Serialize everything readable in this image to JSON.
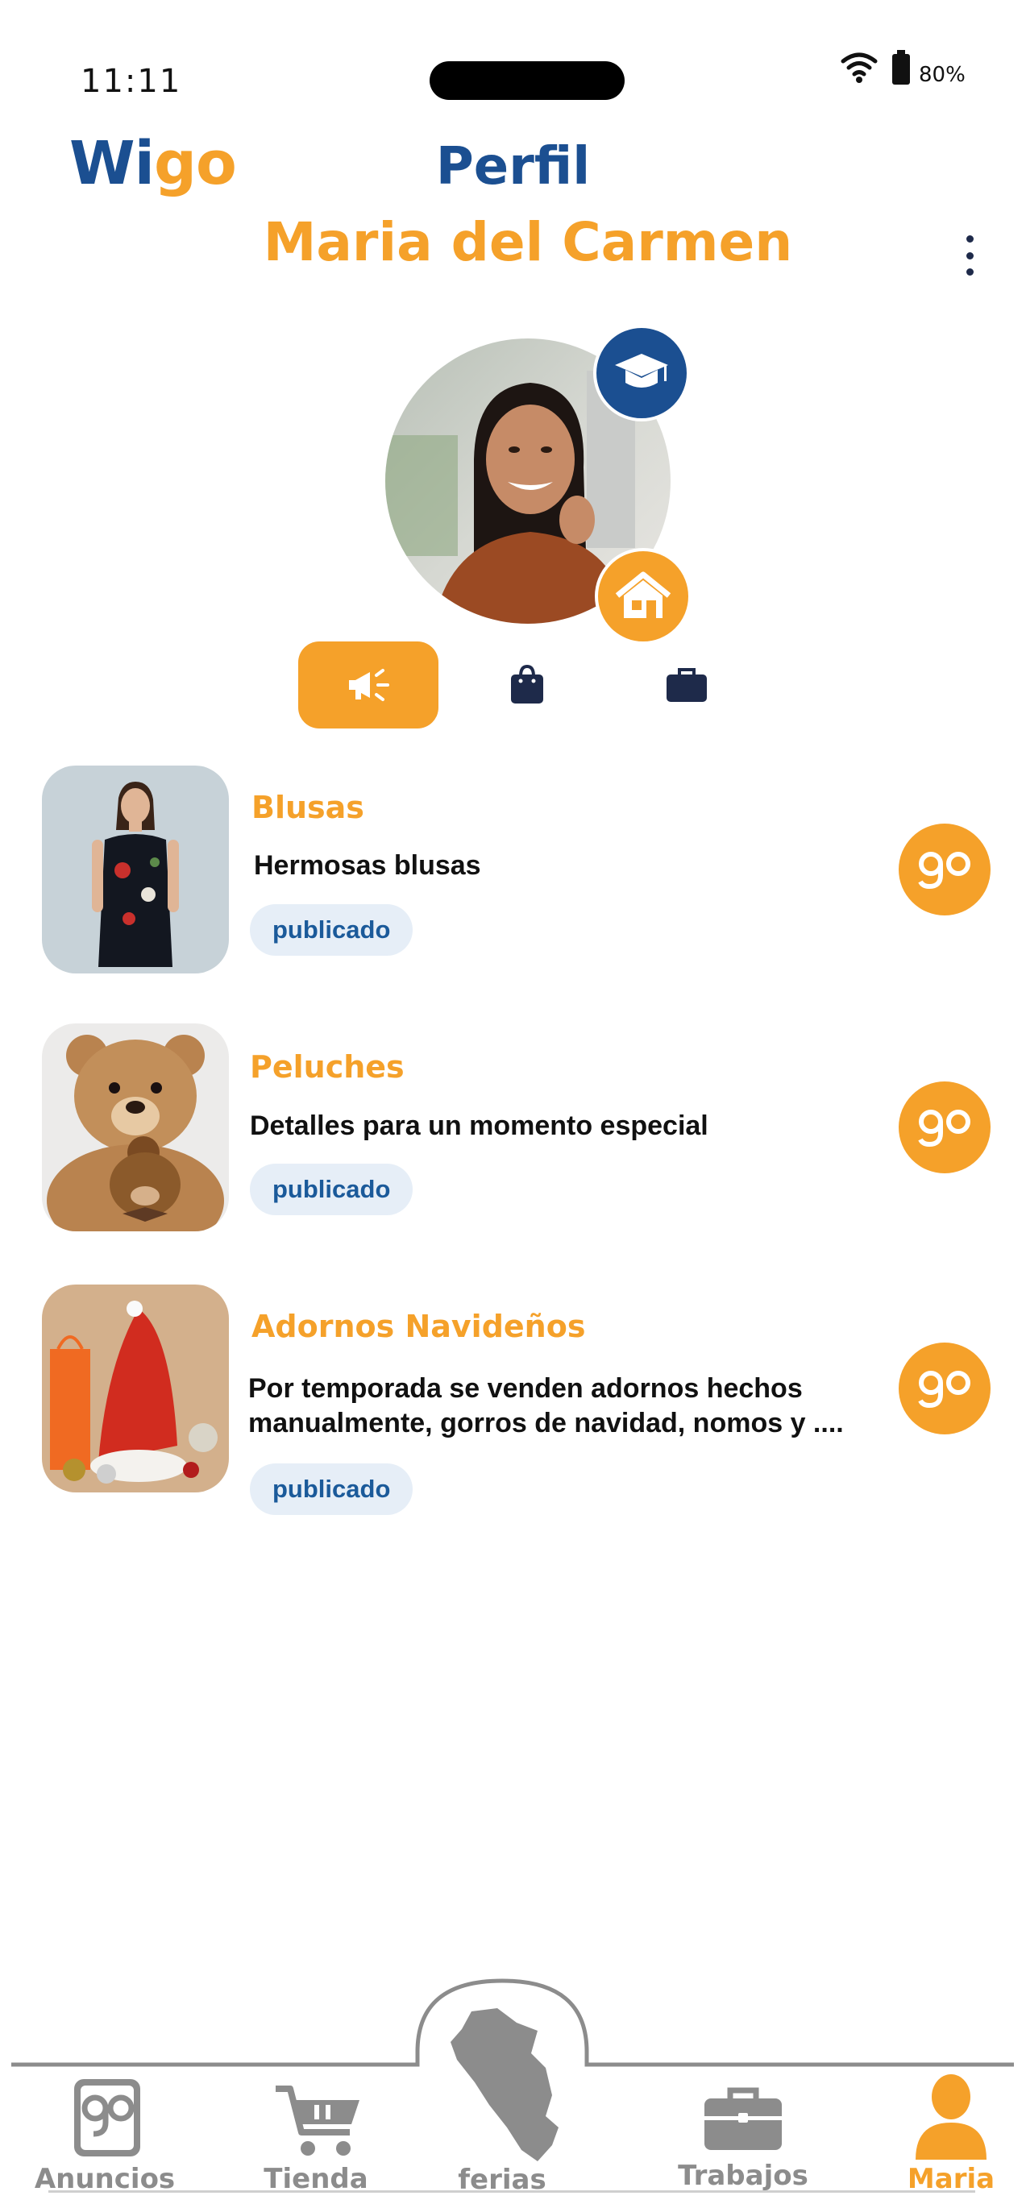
{
  "status_bar": {
    "time": "11:11",
    "battery": "80%"
  },
  "header": {
    "logo_part1": "Wi",
    "logo_part2": "go",
    "title": "Perfil",
    "name": "Maria del Carmen"
  },
  "profile": {
    "badges": [
      "graduation-cap-icon",
      "house-icon"
    ]
  },
  "tabs": [
    {
      "icon": "megaphone-icon",
      "active": true
    },
    {
      "icon": "shopping-bag-icon",
      "active": false
    },
    {
      "icon": "briefcase-icon",
      "active": false
    }
  ],
  "listings": [
    {
      "title": "Blusas",
      "description": "Hermosas blusas",
      "status": "publicado",
      "action": "go"
    },
    {
      "title": "Peluches",
      "description": "Detalles para un momento especial",
      "status": "publicado",
      "action": "go"
    },
    {
      "title": "Adornos Navideños",
      "description": "Por temporada se venden adornos hechos manualmente, gorros de navidad, nomos y ....",
      "status": "publicado",
      "action": "go"
    }
  ],
  "bottom_nav": {
    "items": [
      {
        "label": "Anuncios",
        "icon": "go-icon",
        "active": false
      },
      {
        "label": "Tienda",
        "icon": "cart-icon",
        "active": false
      },
      {
        "label": "ferias",
        "icon": "peru-map-icon",
        "active": false
      },
      {
        "label": "Trabajos",
        "icon": "briefcase-icon",
        "active": false
      },
      {
        "label": "Maria",
        "icon": "user-icon",
        "active": true
      }
    ]
  },
  "colors": {
    "brand_orange": "#f5a12a",
    "brand_blue": "#1b4f91",
    "nav_gray": "#8c8c8c"
  }
}
